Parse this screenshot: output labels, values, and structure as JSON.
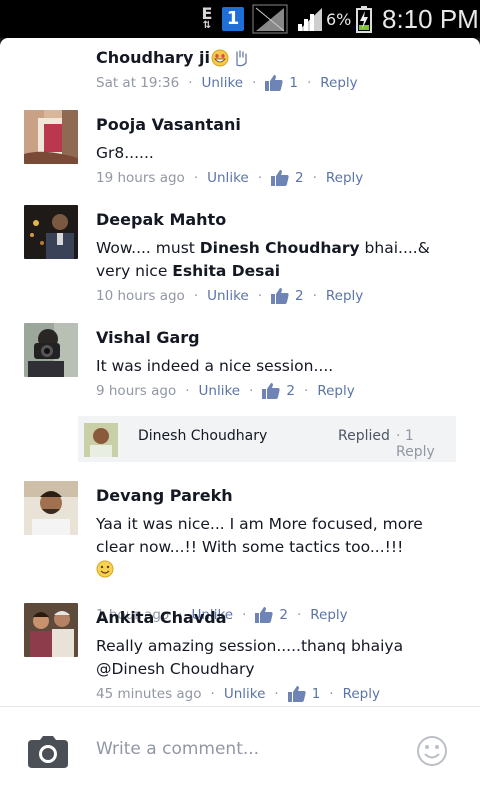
{
  "status_bar": {
    "network_type": "E",
    "notification_badge": "1",
    "battery_percent": "6%",
    "time": "8:10 PM"
  },
  "comments": [
    {
      "name": "Choudhary ji",
      "time": "Sat at 19:36",
      "like_action": "Unlike",
      "like_count": "1",
      "reply_action": "Reply"
    },
    {
      "name": "Pooja Vasantani",
      "text": "Gr8......",
      "time": "19 hours ago",
      "like_action": "Unlike",
      "like_count": "2",
      "reply_action": "Reply"
    },
    {
      "name": "Deepak Mahto",
      "text_before": "Wow.... must ",
      "tag1": "Dinesh Choudhary",
      "text_mid": " bhai....& very nice ",
      "tag2": "Eshita Desai",
      "time": "10 hours ago",
      "like_action": "Unlike",
      "like_count": "2",
      "reply_action": "Reply"
    },
    {
      "name": "Vishal Garg",
      "text": "It was indeed a nice session....",
      "time": "9 hours ago",
      "like_action": "Unlike",
      "like_count": "2",
      "reply_action": "Reply",
      "reply_preview": {
        "name": "Dinesh Choudhary",
        "status": "Replied",
        "count": "1 Reply"
      }
    },
    {
      "name": "Devang Parekh",
      "text": "Yaa it was nice... I am More focused, more clear now...!! With some tactics too...!!!",
      "time": "1 hour ago",
      "like_action": "Unlike",
      "like_count": "2",
      "reply_action": "Reply"
    },
    {
      "name": "Ankita Chavda",
      "text": "Really amazing session.....thanq bhaiya @Dinesh Choudhary",
      "time": "45 minutes ago",
      "like_action": "Unlike",
      "like_count": "1",
      "reply_action": "Reply"
    }
  ],
  "composer": {
    "placeholder": "Write a comment...",
    "camera_icon": "camera-icon",
    "emoji_icon": "smiley-icon"
  },
  "colors": {
    "link_blue": "#5b74a8",
    "meta_gray": "#9197a3",
    "text_dark": "#141823"
  }
}
